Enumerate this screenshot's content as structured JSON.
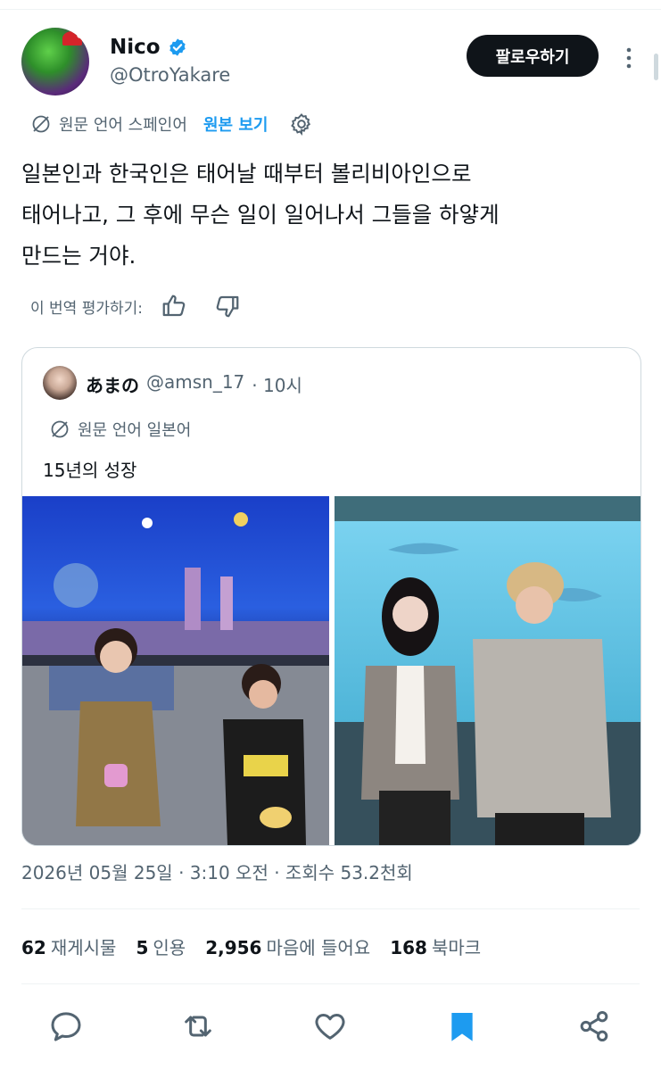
{
  "user": {
    "display_name": "Nico",
    "handle": "@OtroYakare",
    "follow_label": "팔로우하기"
  },
  "translation": {
    "source_lang": "원문 언어 스페인어",
    "show_original": "원본 보기",
    "icons": [
      "globe-icon",
      "gear-icon"
    ]
  },
  "tweet": {
    "text": "일본인과 한국인은 태어날 때부터 볼리비아인으로\n태어나고, 그 후에 무슨 일이 일어나서 그들을 하얗게\n만드는 거야."
  },
  "rating": {
    "label": "이 번역 평가하기:"
  },
  "quote": {
    "name": "あまの",
    "handle": "@amsn_17",
    "time": "· 10시",
    "source_lang": "원문 언어 일본어",
    "text": "15년의 성장"
  },
  "meta": {
    "timestamp": "2026년 05월 25일 · 3:10 오전 · 조회수 53.2천회"
  },
  "stats": {
    "retweets": "62",
    "retweets_label": "재게시물",
    "quotes": "5",
    "quotes_label": "인용",
    "likes": "2,956",
    "likes_label": "마음에 들어요",
    "bookmarks": "168",
    "bookmarks_label": "북마크"
  },
  "colors": {
    "accent": "#1d9bf0",
    "text": "#0f1419",
    "muted": "#536471",
    "border": "#cfd9de"
  }
}
